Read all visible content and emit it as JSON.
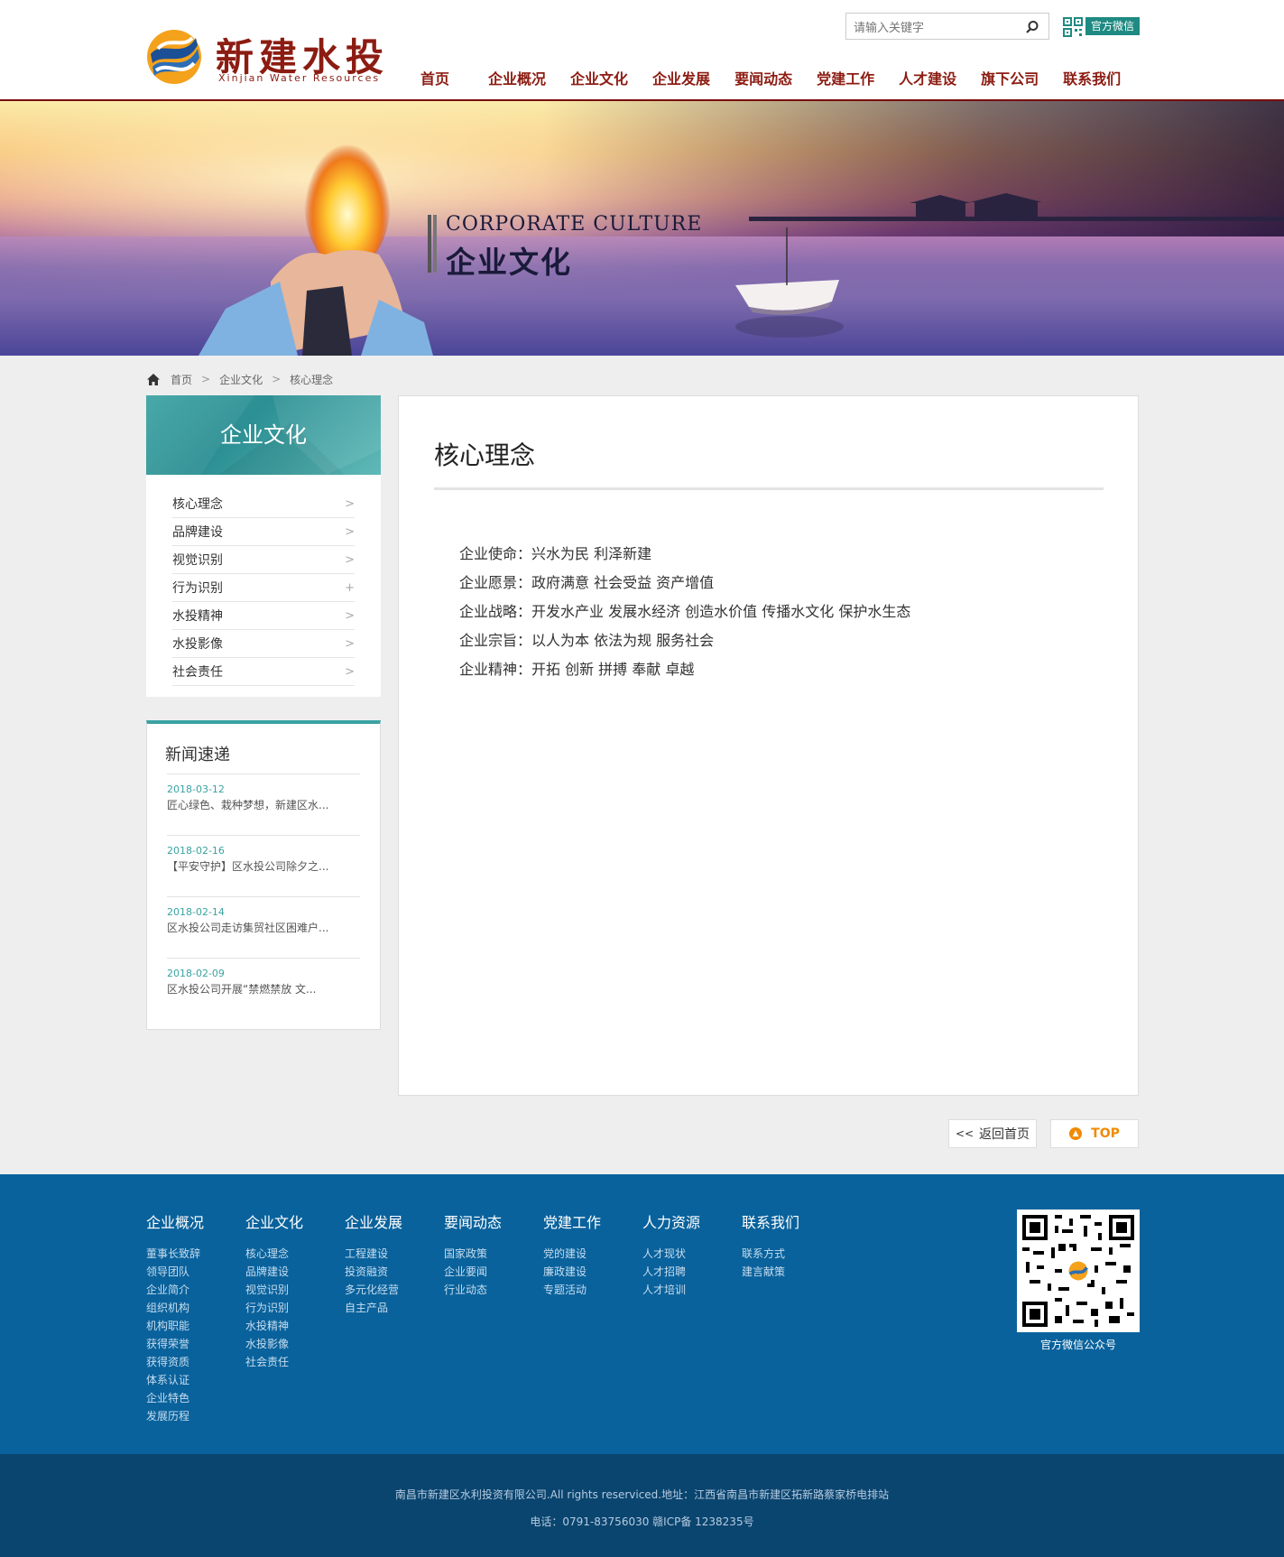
{
  "header": {
    "logo_cn": "新建水投",
    "logo_en": "Xinjian Water Resources",
    "search_placeholder": "请输入关键字",
    "wechat_label": "官方微信",
    "nav": [
      "首页",
      "企业概况",
      "企业文化",
      "企业发展",
      "要闻动态",
      "党建工作",
      "人才建设",
      "旗下公司",
      "联系我们"
    ]
  },
  "banner": {
    "en": "CORPORATE CULTURE",
    "cn": "企业文化"
  },
  "breadcrumb": [
    "首页",
    "企业文化",
    "核心理念"
  ],
  "sidebar": {
    "title": "企业文化",
    "items": [
      {
        "label": "核心理念",
        "icon": "chevron-right"
      },
      {
        "label": "品牌建设",
        "icon": "chevron-right"
      },
      {
        "label": "视觉识别",
        "icon": "chevron-right"
      },
      {
        "label": "行为识别",
        "icon": "plus"
      },
      {
        "label": "水投精神",
        "icon": "chevron-right"
      },
      {
        "label": "水投影像",
        "icon": "chevron-right"
      },
      {
        "label": "社会责任",
        "icon": "chevron-right"
      }
    ]
  },
  "news": {
    "title": "新闻速递",
    "items": [
      {
        "date": "2018-03-12",
        "text": "匠心绿色、栽种梦想，新建区水..."
      },
      {
        "date": "2018-02-16",
        "text": "【平安守护】区水投公司除夕之..."
      },
      {
        "date": "2018-02-14",
        "text": "区水投公司走访集贸社区困难户..."
      },
      {
        "date": "2018-02-09",
        "text": "区水投公司开展“禁燃禁放 文..."
      }
    ]
  },
  "content": {
    "title": "核心理念",
    "paragraphs": [
      "企业使命：兴水为民  利泽新建",
      "企业愿景：政府满意  社会受益  资产增值",
      "企业战略：开发水产业  发展水经济  创造水价值  传播水文化  保护水生态",
      "企业宗旨：以人为本  依法为规  服务社会",
      "企业精神：开拓  创新  拼搏  奉献  卓越"
    ]
  },
  "buttons": {
    "home": "返回首页",
    "top": "TOP"
  },
  "footer": {
    "columns": [
      {
        "head": "企业概况",
        "links": [
          "董事长致辞",
          "领导团队",
          "企业简介",
          "组织机构",
          "机构职能",
          "获得荣誉",
          "获得资质",
          "体系认证",
          "企业特色",
          "发展历程"
        ]
      },
      {
        "head": "企业文化",
        "links": [
          "核心理念",
          "品牌建设",
          "视觉识别",
          "行为识别",
          "水投精神",
          "水投影像",
          "社会责任"
        ]
      },
      {
        "head": "企业发展",
        "links": [
          "工程建设",
          "投资融资",
          "多元化经营",
          "自主产品"
        ]
      },
      {
        "head": "要闻动态",
        "links": [
          "国家政策",
          "企业要闻",
          "行业动态"
        ]
      },
      {
        "head": "党建工作",
        "links": [
          "党的建设",
          "廉政建设",
          "专题活动"
        ]
      },
      {
        "head": "人力资源",
        "links": [
          "人才现状",
          "人才招聘",
          "人才培训"
        ]
      },
      {
        "head": "联系我们",
        "links": [
          "联系方式",
          "建言献策"
        ]
      }
    ],
    "qr_caption": "官方微信公众号",
    "copyright": "南昌市新建区水利投资有限公司.All rights reserviced.地址：江西省南昌市新建区拓新路蔡家桥电排站",
    "contact": "电话：0791-83756030 赣ICP备 1238235号"
  },
  "colors": {
    "brand_red": "#8c1c12",
    "teal": "#39a3a2",
    "footer_blue": "#09629c",
    "footer_dark": "#0a456f",
    "top_orange": "#f08a00"
  }
}
